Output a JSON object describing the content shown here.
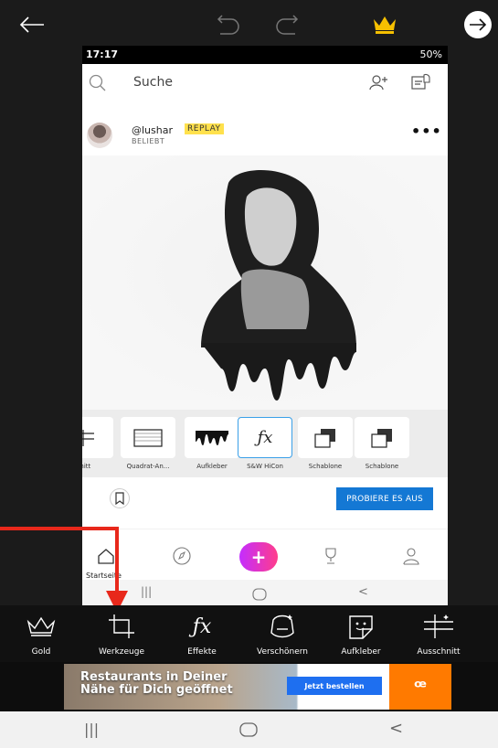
{
  "topbar": {
    "back_icon": "arrow-left-icon",
    "undo_icon": "undo-icon",
    "redo_icon": "redo-icon",
    "premium_icon": "crown-icon",
    "next_icon": "arrow-right-circle-icon",
    "crown_color": "#f6c000"
  },
  "screenshot": {
    "status": {
      "time": "17:17",
      "battery": "50%"
    },
    "search": {
      "label": "Suche"
    },
    "post": {
      "username": "@lushar",
      "badge": "REPLAY",
      "subtitle": "BELIEBT"
    },
    "tools": [
      {
        "label": "Schnitt",
        "selected": false
      },
      {
        "label": "Quadrat-An...",
        "selected": false
      },
      {
        "label": "Aufkleber",
        "selected": false
      },
      {
        "label": "S&W HiCon",
        "selected": true
      },
      {
        "label": "Schablone",
        "selected": false
      },
      {
        "label": "Schablone",
        "selected": false
      }
    ],
    "try_button": "PROBIERE ES AUS",
    "nav": {
      "home_label": "Startseite"
    }
  },
  "toolbar": [
    {
      "label": "Gold",
      "icon": "crown-outline-icon"
    },
    {
      "label": "Werkzeuge",
      "icon": "crop-icon"
    },
    {
      "label": "Effekte",
      "icon": "fx-icon"
    },
    {
      "label": "Verschönern",
      "icon": "beautify-icon"
    },
    {
      "label": "Aufkleber",
      "icon": "sticker-icon"
    },
    {
      "label": "Ausschnitt",
      "icon": "cutout-icon"
    }
  ],
  "ad": {
    "headline_line1": "Restaurants in Deiner",
    "headline_line2": "Nähe für Dich geöffnet",
    "button": "Jetzt bestellen",
    "logo": "ꟹ"
  },
  "colors": {
    "accent": "#1478d4",
    "annotation": "#e8281b",
    "fab": "#d92fd0"
  }
}
